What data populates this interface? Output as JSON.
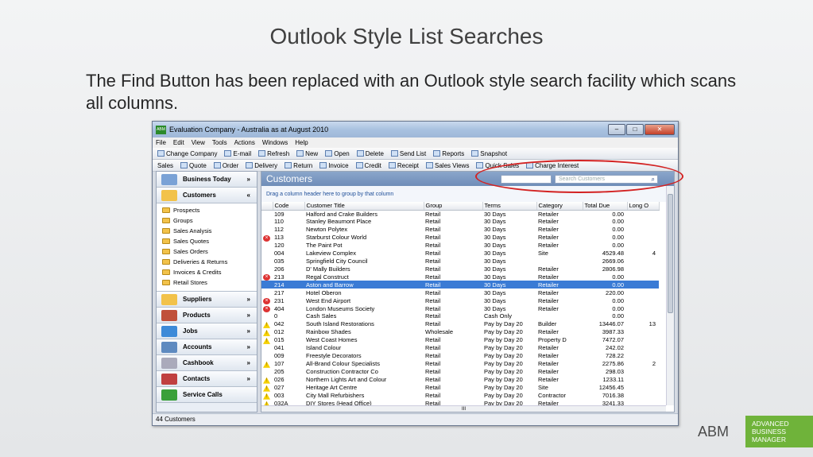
{
  "slide": {
    "title": "Outlook Style List Searches",
    "body": "The Find Button has been replaced with an Outlook style search facility which scans all columns."
  },
  "window": {
    "title": "Evaluation Company - Australia as at August 2010",
    "icon_text": "ABM",
    "menu": [
      "File",
      "Edit",
      "View",
      "Tools",
      "Actions",
      "Windows",
      "Help"
    ],
    "toolbar1": [
      "Change Company",
      "E-mail",
      "Refresh",
      "New",
      "Open",
      "Delete",
      "Send List",
      "Reports",
      "Snapshot"
    ],
    "toolbar2": [
      "Sales",
      "Quote",
      "Order",
      "Delivery",
      "Return",
      "Invoice",
      "Credit",
      "Receipt",
      "Sales Views",
      "Quick Sales",
      "Charge Interest"
    ]
  },
  "nav": {
    "sections_top": [
      {
        "label": "Business Today",
        "chev": "»"
      },
      {
        "label": "Customers",
        "chev": "«"
      }
    ],
    "items": [
      "Prospects",
      "Groups",
      "Sales Analysis",
      "Sales Quotes",
      "Sales Orders",
      "Deliveries & Returns",
      "Invoices & Credits",
      "Retail Stores"
    ],
    "sections_bottom": [
      {
        "label": "Suppliers",
        "chev": "»"
      },
      {
        "label": "Products",
        "chev": "»"
      },
      {
        "label": "Jobs",
        "chev": "»"
      },
      {
        "label": "Accounts",
        "chev": "»"
      },
      {
        "label": "Cashbook",
        "chev": "»"
      },
      {
        "label": "Contacts",
        "chev": "»"
      },
      {
        "label": "Service Calls",
        "chev": ""
      }
    ]
  },
  "main": {
    "header": "Customers",
    "search_placeholder": "Search Customers",
    "group_hint": "Drag a column header here to group by that column",
    "columns": [
      "Code",
      "Customer Title",
      "Group",
      "Terms",
      "Category",
      "Total Due",
      "Long O"
    ],
    "rows": [
      {
        "s": "",
        "code": "109",
        "title": "Halford and Crake Builders",
        "group": "Retail",
        "terms": "30 Days",
        "cat": "Retailer",
        "due": "0.00",
        "long": ""
      },
      {
        "s": "",
        "code": "110",
        "title": "Stanley Beaumont Place",
        "group": "Retail",
        "terms": "30 Days",
        "cat": "Retailer",
        "due": "0.00",
        "long": ""
      },
      {
        "s": "",
        "code": "112",
        "title": "Newton Polytex",
        "group": "Retail",
        "terms": "30 Days",
        "cat": "Retailer",
        "due": "0.00",
        "long": ""
      },
      {
        "s": "err",
        "code": "113",
        "title": "Starburst Colour World",
        "group": "Retail",
        "terms": "30 Days",
        "cat": "Retailer",
        "due": "0.00",
        "long": ""
      },
      {
        "s": "",
        "code": "120",
        "title": "The Paint Pot",
        "group": "Retail",
        "terms": "30 Days",
        "cat": "Retailer",
        "due": "0.00",
        "long": ""
      },
      {
        "s": "",
        "code": "004",
        "title": "Lakeview Complex",
        "group": "Retail",
        "terms": "30 Days",
        "cat": "Site",
        "due": "4529.48",
        "long": "4"
      },
      {
        "s": "",
        "code": "035",
        "title": "Springfield City Council",
        "group": "Retail",
        "terms": "30 Days",
        "cat": "",
        "due": "2669.06",
        "long": ""
      },
      {
        "s": "",
        "code": "206",
        "title": "D' Mally Builders",
        "group": "Retail",
        "terms": "30 Days",
        "cat": "Retailer",
        "due": "2806.98",
        "long": ""
      },
      {
        "s": "err",
        "code": "213",
        "title": "Regal Construct",
        "group": "Retail",
        "terms": "30 Days",
        "cat": "Retailer",
        "due": "0.00",
        "long": ""
      },
      {
        "s": "",
        "code": "214",
        "title": "Aston and Barrow",
        "group": "Retail",
        "terms": "30 Days",
        "cat": "Retailer",
        "due": "0.00",
        "long": "",
        "sel": true
      },
      {
        "s": "",
        "code": "217",
        "title": "Hotel Oberon",
        "group": "Retail",
        "terms": "30 Days",
        "cat": "Retailer",
        "due": "220.00",
        "long": ""
      },
      {
        "s": "err",
        "code": "231",
        "title": "West End Airport",
        "group": "Retail",
        "terms": "30 Days",
        "cat": "Retailer",
        "due": "0.00",
        "long": ""
      },
      {
        "s": "err",
        "code": "404",
        "title": "London Museums Society",
        "group": "Retail",
        "terms": "30 Days",
        "cat": "Retailer",
        "due": "0.00",
        "long": ""
      },
      {
        "s": "",
        "code": "0",
        "title": "Cash Sales",
        "group": "Retail",
        "terms": "Cash Only",
        "cat": "",
        "due": "0.00",
        "long": ""
      },
      {
        "s": "warn",
        "code": "042",
        "title": "South Island Restorations",
        "group": "Retail",
        "terms": "Pay by Day 20",
        "cat": "Builder",
        "due": "13446.07",
        "long": "13"
      },
      {
        "s": "warn",
        "code": "012",
        "title": "Rainbow Shades",
        "group": "Wholesale",
        "terms": "Pay by Day 20",
        "cat": "Retailer",
        "due": "3987.33",
        "long": ""
      },
      {
        "s": "warn",
        "code": "015",
        "title": "West Coast Homes",
        "group": "Retail",
        "terms": "Pay by Day 20",
        "cat": "Property D",
        "due": "7472.07",
        "long": ""
      },
      {
        "s": "",
        "code": "041",
        "title": "Island Colour",
        "group": "Retail",
        "terms": "Pay by Day 20",
        "cat": "Retailer",
        "due": "242.02",
        "long": ""
      },
      {
        "s": "",
        "code": "009",
        "title": "Freestyle Decorators",
        "group": "Retail",
        "terms": "Pay by Day 20",
        "cat": "Retailer",
        "due": "728.22",
        "long": ""
      },
      {
        "s": "warn",
        "code": "107",
        "title": "All-Brand Colour Specialists",
        "group": "Retail",
        "terms": "Pay by Day 20",
        "cat": "Retailer",
        "due": "2275.86",
        "long": "2"
      },
      {
        "s": "",
        "code": "205",
        "title": "Construction Contractor Co",
        "group": "Retail",
        "terms": "Pay by Day 20",
        "cat": "Retailer",
        "due": "298.03",
        "long": ""
      },
      {
        "s": "warn",
        "code": "026",
        "title": "Northern Lights Art and Colour",
        "group": "Retail",
        "terms": "Pay by Day 20",
        "cat": "Retailer",
        "due": "1233.11",
        "long": ""
      },
      {
        "s": "warn",
        "code": "027",
        "title": "Heritage Art Centre",
        "group": "Retail",
        "terms": "Pay by Day 20",
        "cat": "Site",
        "due": "12456.45",
        "long": ""
      },
      {
        "s": "warn",
        "code": "003",
        "title": "City Mall Refurbishers",
        "group": "Retail",
        "terms": "Pay by Day 20",
        "cat": "Contractor",
        "due": "7016.38",
        "long": ""
      },
      {
        "s": "warn",
        "code": "032A",
        "title": "DIY Stores (Head Office)",
        "group": "Retail",
        "terms": "Pay by Day 20",
        "cat": "Retailer",
        "due": "3241.33",
        "long": ""
      }
    ]
  },
  "status": "44 Customers",
  "logo": {
    "mark": "ABM",
    "line1": "ADVANCED",
    "line2": "BUSINESS",
    "line3": "MANAGER"
  }
}
